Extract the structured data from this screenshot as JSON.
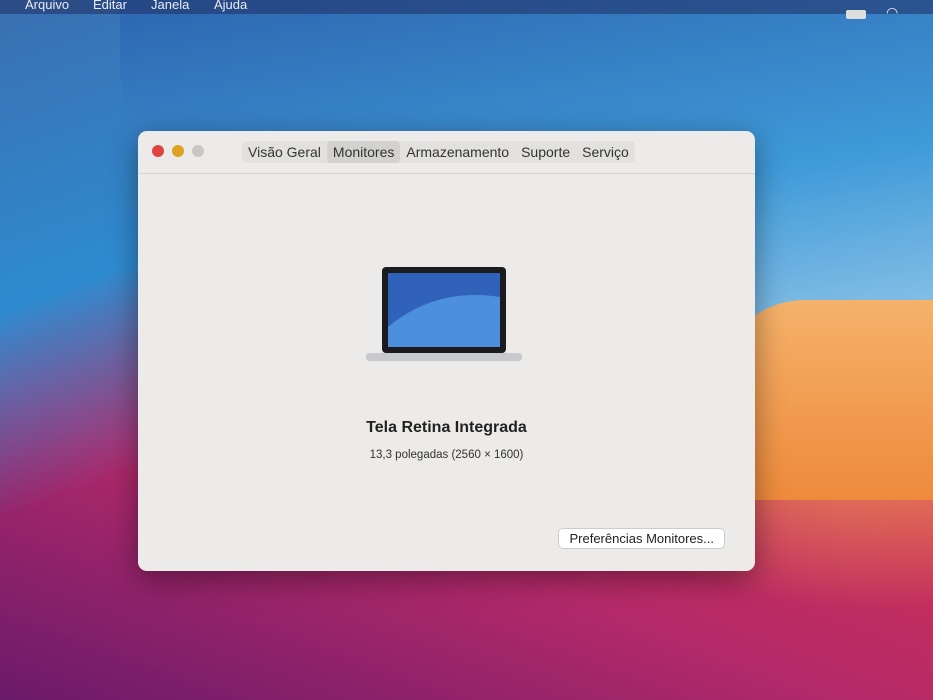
{
  "menubar": {
    "items": [
      "Arquivo",
      "Editar",
      "Janela",
      "Ajuda"
    ]
  },
  "window": {
    "tabs": [
      {
        "label": "Visão Geral"
      },
      {
        "label": "Monitores",
        "selected": true
      },
      {
        "label": "Armazenamento"
      },
      {
        "label": "Suporte"
      },
      {
        "label": "Serviço"
      }
    ],
    "display_name": "Tela Retina Integrada",
    "display_spec": "13,3 polegadas (2560 × 1600)",
    "prefs_button": "Preferências Monitores..."
  },
  "colors": {
    "close": "#e0443e",
    "minimize": "#dea123",
    "zoom": "#c8c7c5"
  }
}
